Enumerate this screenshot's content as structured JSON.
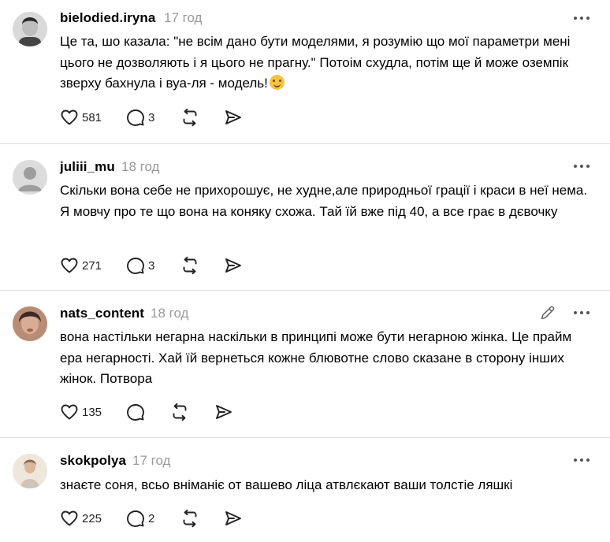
{
  "comments": [
    {
      "username": "bielodied.iryna",
      "time": "17 год",
      "avatar_icon": "user-photo-avatar",
      "text": "Це та, шо казала: \"не всім дано бути моделями, я розумію що мої параметри мені цього не дозволяють і я цього не прагну.\" Потоім схудла, потім ще й може оземпік зверху бахнула і вуа-ля - модель!",
      "emoji": "grinning-face-emoji",
      "likes": "581",
      "replies": "3"
    },
    {
      "username": "juliii_mu",
      "time": "18 год",
      "avatar_icon": "default-user-avatar",
      "text": "Скільки вона себе не прихорошує, не худне,але природньої грації і краси в неї нема. Я мовчу про те що вона на коняку схожа. Тай їй вже під 40, а все грає в дєвочку",
      "likes": "271",
      "replies": "3"
    },
    {
      "username": "nats_content",
      "time": "18 год",
      "avatar_icon": "user-photo-avatar",
      "text": "вона настільки негарна наскільки в принципі може бути негарною жінка. Це прайм ера негарності. Хай їй вернеться кожне блювотне слово сказане в сторону інших жінок. Потвора",
      "likes": "135",
      "replies": ""
    },
    {
      "username": "skokpolya",
      "time": "17 год",
      "avatar_icon": "user-photo-avatar",
      "text": "знаєте соня, всьо вніманіє от вашево ліца атвлєкают ваши толстіе ляшкі",
      "likes": "225",
      "replies": "2"
    }
  ],
  "icons": {
    "like": "heart-icon",
    "reply": "comment-icon",
    "repost": "repost-icon",
    "share": "send-icon",
    "more": "more-options-icon",
    "edit": "edit-pencil-icon"
  }
}
